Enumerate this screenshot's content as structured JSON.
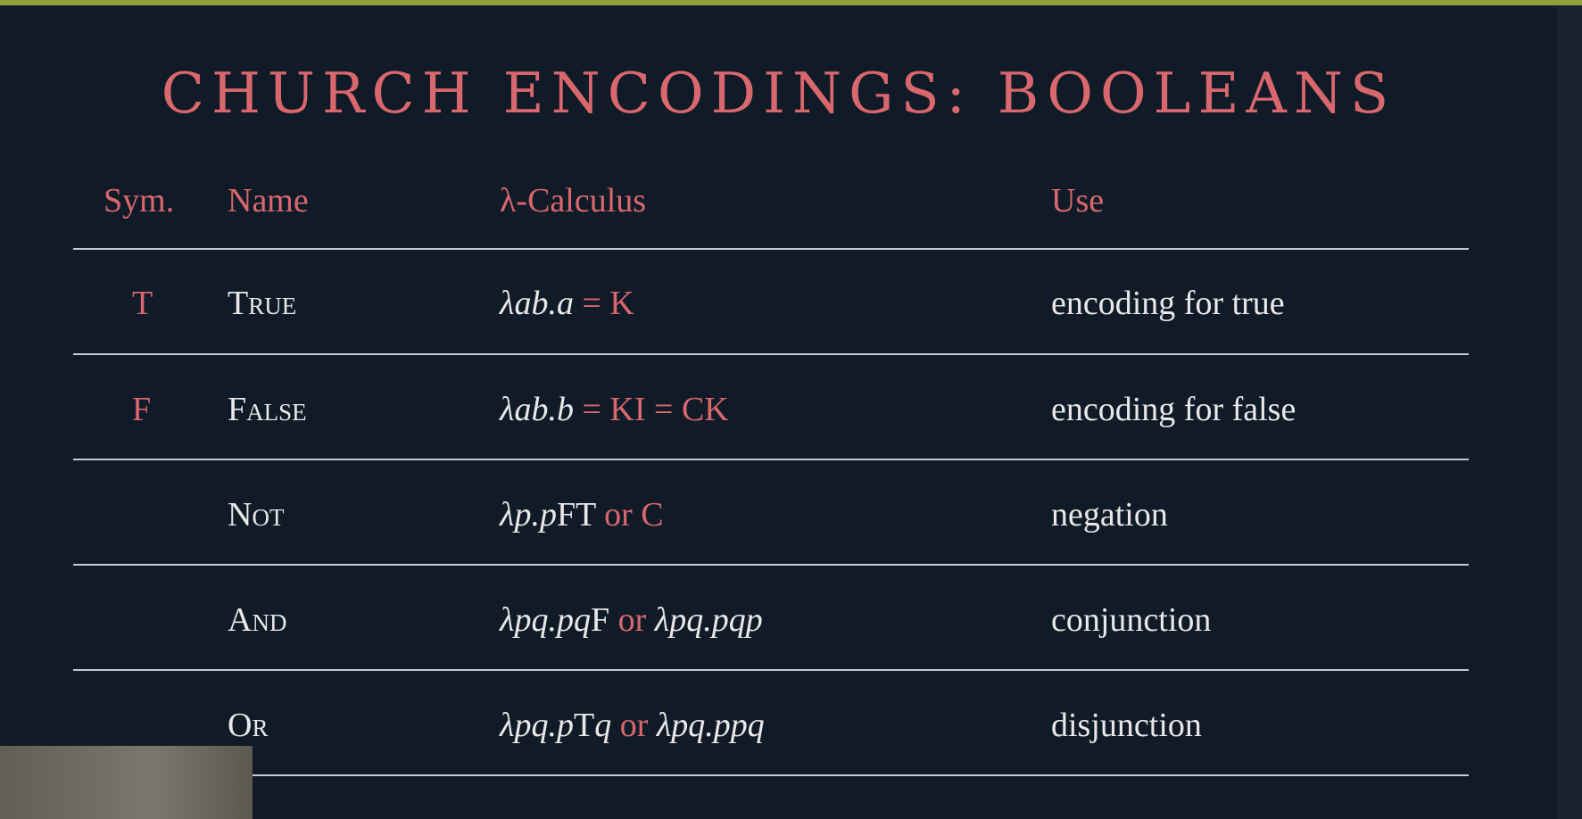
{
  "title": "CHURCH ENCODINGS: BOOLEANS",
  "headers": {
    "sym": "Sym.",
    "name": "Name",
    "lambda": "λ-Calculus",
    "use": "Use"
  },
  "rows": [
    {
      "sym": "T",
      "name": "True",
      "lambda": {
        "expr": "λab.a",
        "eq1": " = ",
        "alt1": "K",
        "eq2": "",
        "alt2": ""
      },
      "use": "encoding for true"
    },
    {
      "sym": "F",
      "name": "False",
      "lambda": {
        "expr": "λab.b",
        "eq1": " = ",
        "alt1": "KI",
        "eq2": " = ",
        "alt2": "CK"
      },
      "use": "encoding for false"
    },
    {
      "sym": "",
      "name": "Not",
      "lambda": {
        "expr1": "λp.p",
        "roman1": "FT",
        "or": " or ",
        "alt": "C"
      },
      "use": "negation"
    },
    {
      "sym": "",
      "name": "And",
      "lambda": {
        "expr1": "λpq.pq",
        "roman1": "F",
        "or": " or ",
        "expr2": "λpq.pqp"
      },
      "use": "conjunction"
    },
    {
      "sym": "",
      "name": "Or",
      "lambda": {
        "expr1": "λpq.p",
        "roman1": "T",
        "expr1b": "q",
        "or": " or ",
        "expr2": "λpq.ppq"
      },
      "use": "disjunction"
    }
  ]
}
